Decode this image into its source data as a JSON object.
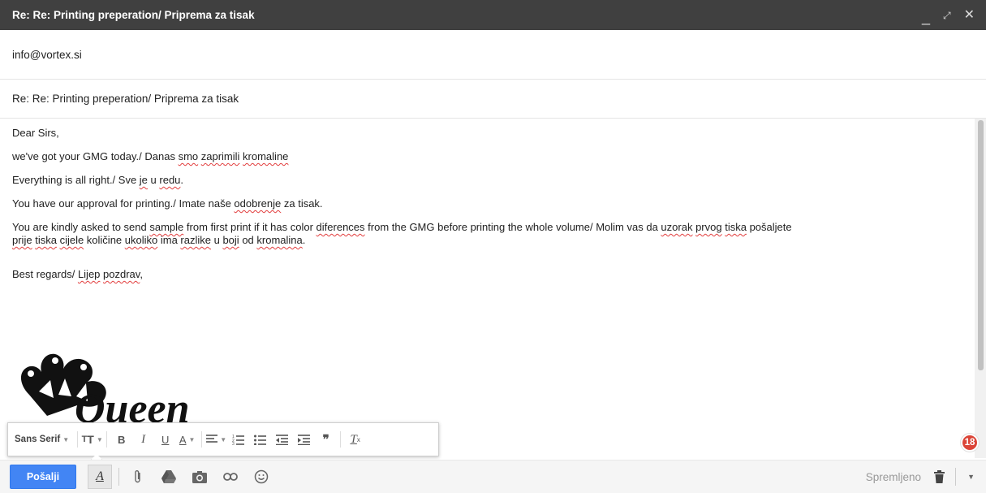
{
  "window": {
    "title": "Re: Re: Printing preperation/ Priprema za tisak"
  },
  "recipient": "info@vortex.si",
  "subject": "Re: Re: Printing preperation/ Priprema za tisak",
  "body": {
    "greeting": "Dear Sirs,",
    "line1": {
      "a": "we've got your GMG today./ Danas ",
      "b": "smo",
      "c": " ",
      "d": "zaprimili",
      "e": " ",
      "f": "kromaline"
    },
    "line2": {
      "a": "Everything is all right./ Sve ",
      "b": "je",
      "c": " u ",
      "d": "redu",
      "e": "."
    },
    "line3": {
      "a": "You have our approval for printing./ Imate naše ",
      "b": "odobrenje",
      "c": " za tisak."
    },
    "line4": {
      "p1": "You are kindly asked to send ",
      "s1": "sample",
      "p2": " from first print if it has color ",
      "s2": "diferences",
      "p3": " from the GMG before printing the whole volume/ Molim vas da ",
      "s3": "uzorak",
      "p4": " ",
      "s4": "prvog",
      "p5": " ",
      "s5": "tiska",
      "p6": " pošaljete",
      "s6": "prije",
      "p7": " ",
      "s7": "tiska",
      "p8": " ",
      "s8": "cijele",
      "p9": " količine ",
      "s9": "ukoliko",
      "p10": " ima ",
      "s10": "razlike",
      "p11": " u ",
      "s11": "boji",
      "p12": " od ",
      "s12": "kromalina",
      "p13": "."
    },
    "closing": {
      "a": "Best regards/ ",
      "b": "Lijep",
      "c": " ",
      "d": "pozdrav",
      "e": ","
    },
    "signature_logo_text": "Queen"
  },
  "format_toolbar": {
    "font": "Sans Serif",
    "bold": "B",
    "italic": "I",
    "underline": "U",
    "text_color": "A",
    "clear": "T"
  },
  "badge_count": "18",
  "bottom": {
    "send_label": "Pošalji",
    "saved_label": "Spremljeno"
  },
  "colors": {
    "titlebar": "#404040",
    "send": "#4285f4",
    "badge": "#db4437",
    "spellcheck": "#e23d3d"
  },
  "icons": [
    "minimize-icon",
    "pop-out-icon",
    "close-icon",
    "text-size-icon",
    "align-icon",
    "numbered-list-icon",
    "bulleted-list-icon",
    "indent-less-icon",
    "indent-more-icon",
    "quote-icon",
    "remove-formatting-icon",
    "formatting-icon",
    "attach-icon",
    "drive-icon",
    "photo-icon",
    "link-icon",
    "emoji-icon",
    "trash-icon",
    "more-options-icon"
  ]
}
